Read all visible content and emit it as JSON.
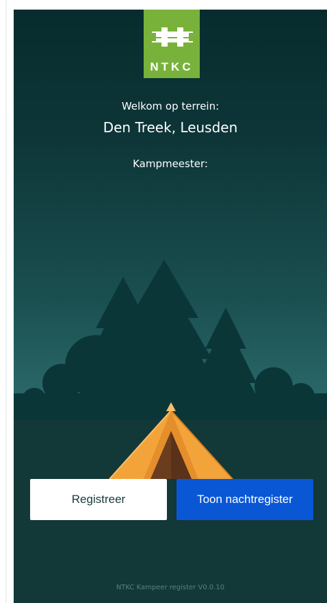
{
  "logo": {
    "text": "NTKC",
    "icon": "ntkc-fence-logo",
    "color": "#79b23a"
  },
  "header": {
    "welcome_label": "Welkom op terrein:",
    "terrain_name": "Den Treek, Leusden",
    "campmaster_label": "Kampmeester:"
  },
  "illustration": {
    "icon": "forest-tent-illustration"
  },
  "actions": {
    "register_label": "Registreer",
    "night_register_label": "Toon nachtregister",
    "primary_color": "#0a57d6"
  },
  "footer": {
    "version_text": "NTKC Kampeer register V0.0.10"
  }
}
